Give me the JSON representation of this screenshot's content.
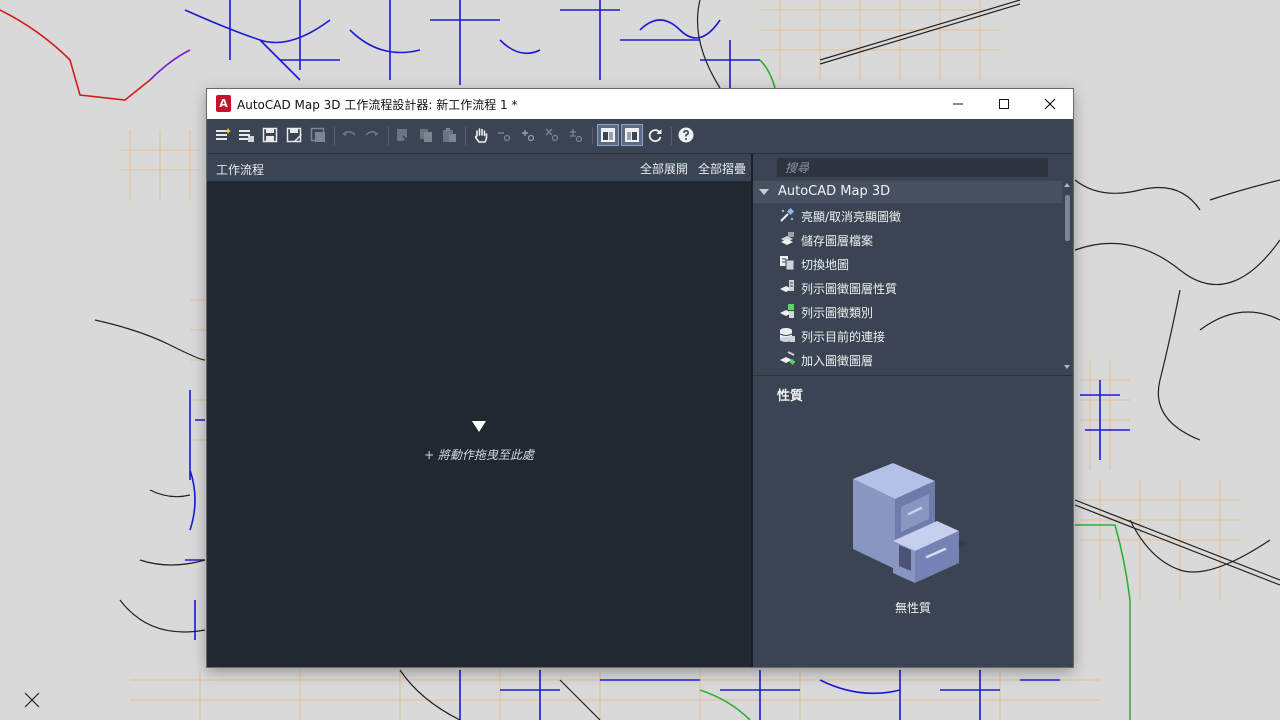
{
  "window": {
    "app_icon_letter": "A",
    "title": "AutoCAD Map 3D 工作流程設計器: 新工作流程 1 *"
  },
  "workflow": {
    "title": "工作流程",
    "expand_all": "全部展開",
    "collapse_all": "全部摺疊",
    "drop_hint": "+ 將動作拖曳至此處"
  },
  "search": {
    "placeholder": "搜尋"
  },
  "tree": {
    "group": "AutoCAD Map 3D",
    "items": [
      {
        "label": "亮顯/取消亮顯圖徵",
        "icon": "highlight-features-icon"
      },
      {
        "label": "儲存圖層檔案",
        "icon": "save-layer-file-icon"
      },
      {
        "label": "切換地圖",
        "icon": "switch-map-icon"
      },
      {
        "label": "列示圖徵圖層性質",
        "icon": "list-layer-properties-icon"
      },
      {
        "label": "列示圖徵類別",
        "icon": "list-feature-classes-icon"
      },
      {
        "label": "列示目前的連接",
        "icon": "list-connections-icon"
      },
      {
        "label": "加入圖徵圖層",
        "icon": "add-feature-layer-icon"
      }
    ]
  },
  "properties": {
    "title": "性質",
    "empty_text": "無性質"
  },
  "colors": {
    "panel_bg": "#3b4453",
    "canvas_bg": "#222832",
    "brand_red": "#c8102e",
    "map_bg": "#d9d9d9",
    "road_blue": "#1a1ad6",
    "parcel_orange": "#e8b98c"
  }
}
